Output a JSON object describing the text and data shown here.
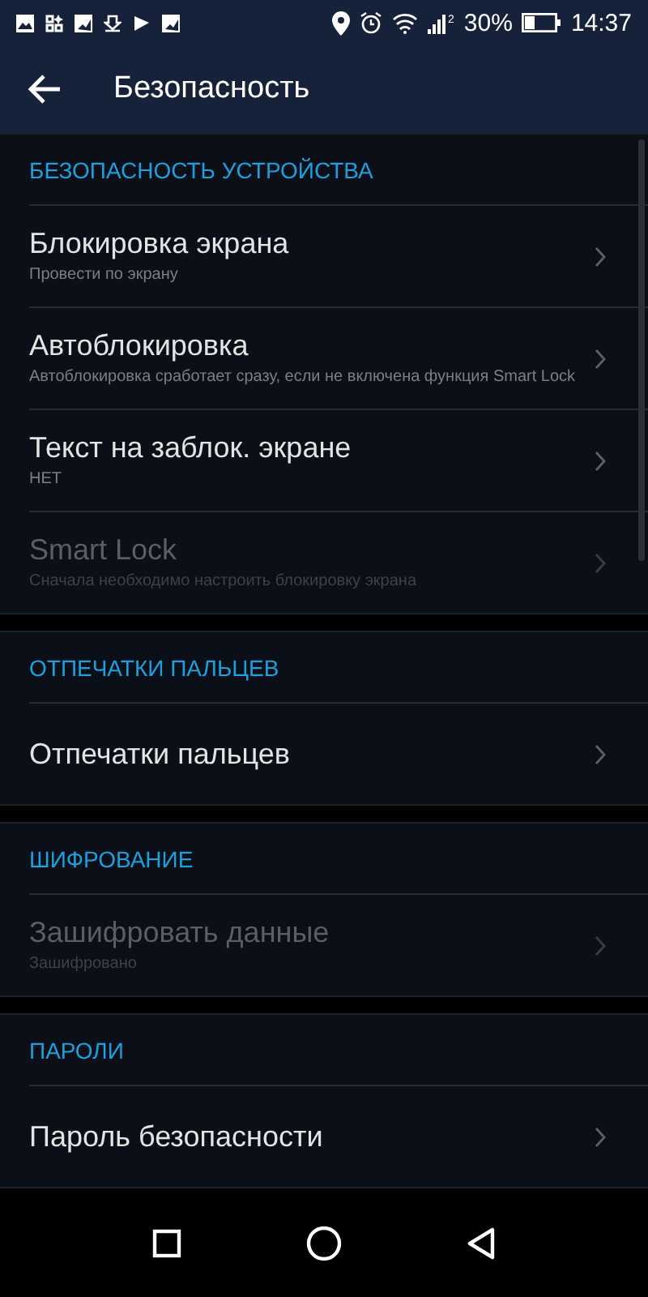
{
  "status_bar": {
    "sim_label": "2",
    "battery": "30%",
    "time": "14:37"
  },
  "app_bar": {
    "title": "Безопасность"
  },
  "sections": [
    {
      "header": "БЕЗОПАСНОСТЬ УСТРОЙСТВА",
      "items": [
        {
          "title": "Блокировка экрана",
          "subtitle": "Провести по экрану",
          "disabled": false
        },
        {
          "title": "Автоблокировка",
          "subtitle": "Автоблокировка сработает сразу, если не включена функция Smart Lock",
          "disabled": false
        },
        {
          "title": "Текст на заблок. экране",
          "subtitle": "НЕТ",
          "disabled": false
        },
        {
          "title": "Smart Lock",
          "subtitle": "Сначала необходимо настроить блокировку экрана",
          "disabled": true
        }
      ]
    },
    {
      "header": "ОТПЕЧАТКИ ПАЛЬЦЕВ",
      "items": [
        {
          "title": "Отпечатки пальцев",
          "disabled": false
        }
      ]
    },
    {
      "header": "ШИФРОВАНИЕ",
      "items": [
        {
          "title": "Зашифровать данные",
          "subtitle": "Зашифровано",
          "disabled": true
        }
      ]
    },
    {
      "header": "ПАРОЛИ",
      "items": [
        {
          "title": "Пароль безопасности",
          "disabled": false
        }
      ]
    }
  ]
}
